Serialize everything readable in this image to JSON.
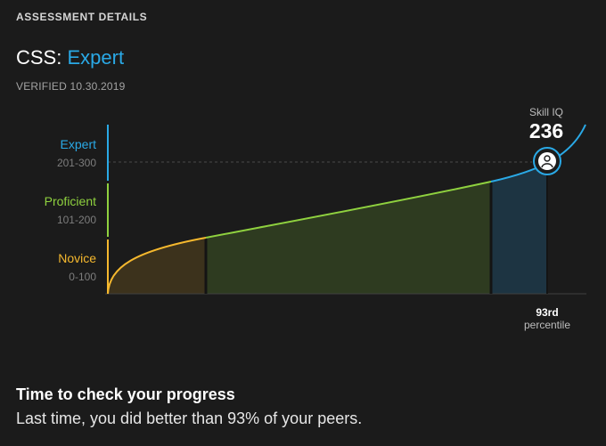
{
  "header": {
    "section_label": "ASSESSMENT DETAILS",
    "skill_prefix": "CSS: ",
    "level": "Expert",
    "verified": "VERIFIED 10.30.2019"
  },
  "colors": {
    "expert": "#2aa9e6",
    "proficient": "#8fd13f",
    "novice": "#f5b82e",
    "background": "#1b1b1b"
  },
  "chart_data": {
    "type": "area",
    "bands": [
      {
        "name": "Expert",
        "range": "201-300"
      },
      {
        "name": "Proficient",
        "range": "101-200"
      },
      {
        "name": "Novice",
        "range": "0-100"
      }
    ],
    "marker": {
      "label": "Skill IQ",
      "value": 236,
      "value_text": "236",
      "percentile": 93,
      "percentile_text": "93rd",
      "percentile_label": "percentile"
    },
    "grid": false
  },
  "footer": {
    "title": "Time to check your progress",
    "text": "Last time, you did better than 93% of your peers."
  }
}
